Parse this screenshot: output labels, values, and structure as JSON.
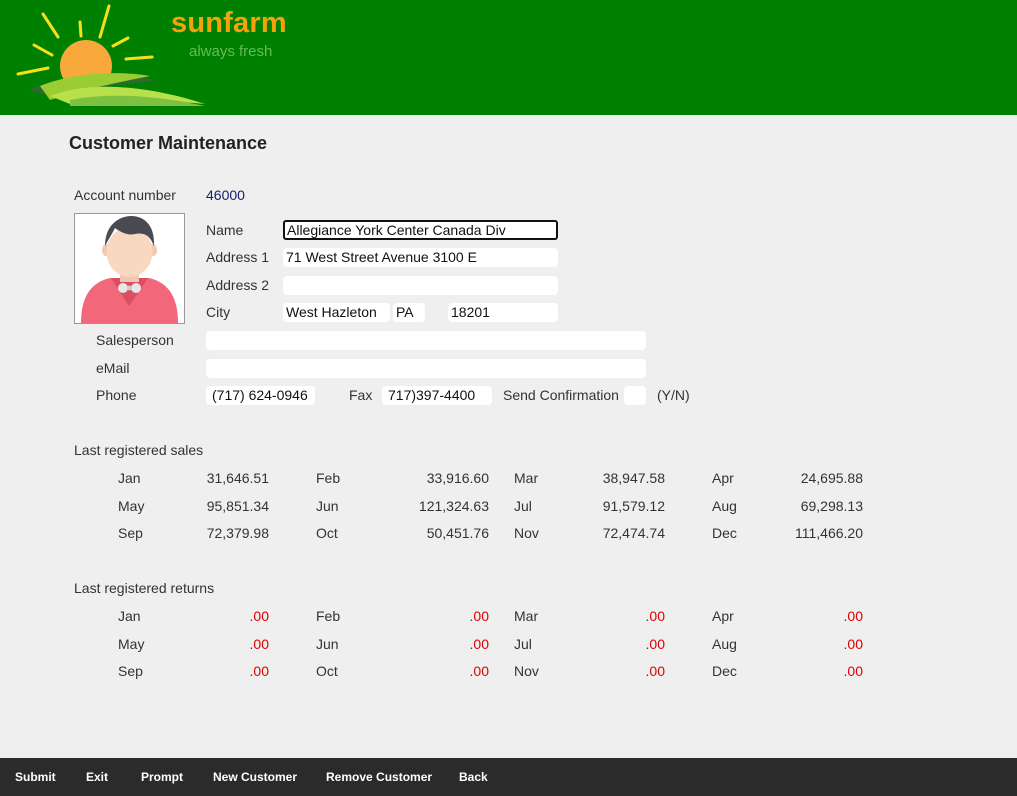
{
  "brand": {
    "name": "sunfarm",
    "tagline": "always fresh"
  },
  "page_title": "Customer Maintenance",
  "customer": {
    "account_label": "Account number",
    "account_number": "46000",
    "name_label": "Name",
    "name": "Allegiance York Center Canada Div",
    "address1_label": "Address 1",
    "address1": "71 West Street Avenue 3100 E",
    "address2_label": "Address 2",
    "address2": "",
    "city_label": "City",
    "city": "West Hazleton",
    "state": "PA",
    "zip": "18201",
    "salesperson_label": "Salesperson",
    "salesperson": "",
    "email_label": "eMail",
    "email": "",
    "phone_label": "Phone",
    "phone": "(717) 624-0946",
    "fax_label": "Fax",
    "fax": "717)397-4400",
    "confirm_label": "Send Confirmation",
    "confirm": "",
    "confirm_hint": "(Y/N)"
  },
  "sales": {
    "title": "Last registered sales",
    "rows": [
      [
        {
          "m": "Jan",
          "v": "31,646.51"
        },
        {
          "m": "Feb",
          "v": "33,916.60"
        },
        {
          "m": "Mar",
          "v": "38,947.58"
        },
        {
          "m": "Apr",
          "v": "24,695.88"
        }
      ],
      [
        {
          "m": "May",
          "v": "95,851.34"
        },
        {
          "m": "Jun",
          "v": "121,324.63"
        },
        {
          "m": "Jul",
          "v": "91,579.12"
        },
        {
          "m": "Aug",
          "v": "69,298.13"
        }
      ],
      [
        {
          "m": "Sep",
          "v": "72,379.98"
        },
        {
          "m": "Oct",
          "v": "50,451.76"
        },
        {
          "m": "Nov",
          "v": "72,474.74"
        },
        {
          "m": "Dec",
          "v": "111,466.20"
        }
      ]
    ]
  },
  "returns": {
    "title": "Last registered returns",
    "value_color": "#e00000",
    "rows": [
      [
        {
          "m": "Jan",
          "v": ".00"
        },
        {
          "m": "Feb",
          "v": ".00"
        },
        {
          "m": "Mar",
          "v": ".00"
        },
        {
          "m": "Apr",
          "v": ".00"
        }
      ],
      [
        {
          "m": "May",
          "v": ".00"
        },
        {
          "m": "Jun",
          "v": ".00"
        },
        {
          "m": "Jul",
          "v": ".00"
        },
        {
          "m": "Aug",
          "v": ".00"
        }
      ],
      [
        {
          "m": "Sep",
          "v": ".00"
        },
        {
          "m": "Oct",
          "v": ".00"
        },
        {
          "m": "Nov",
          "v": ".00"
        },
        {
          "m": "Dec",
          "v": ".00"
        }
      ]
    ]
  },
  "footer": {
    "buttons": [
      "Submit",
      "Exit",
      "Prompt",
      "New Customer",
      "Remove Customer",
      "Back"
    ]
  },
  "colors": {
    "header": "#008000",
    "brand": "#f5a20a",
    "tagline": "#66bb55",
    "footer": "#2b2b2b"
  }
}
